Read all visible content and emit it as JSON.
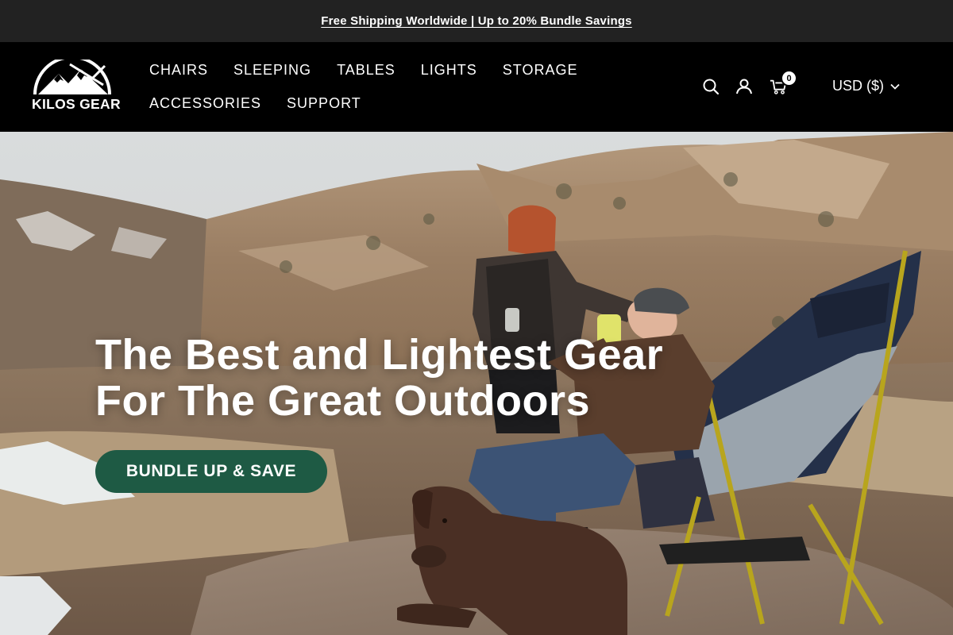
{
  "announcement": {
    "text": "Free Shipping Worldwide | Up to 20% Bundle Savings"
  },
  "brand": {
    "name": "KILOS GEAR"
  },
  "nav": {
    "row1": [
      "CHAIRS",
      "SLEEPING",
      "TABLES",
      "LIGHTS",
      "STORAGE"
    ],
    "row2": [
      "ACCESSORIES",
      "SUPPORT"
    ]
  },
  "header": {
    "icons": [
      "search-icon",
      "account-icon",
      "cart-icon"
    ],
    "cart_count": "0",
    "currency": "USD ($)"
  },
  "hero": {
    "title_line1": "The Best and Lightest Gear",
    "title_line2": "For The Great Outdoors",
    "cta_label": "BUNDLE UP & SAVE"
  },
  "colors": {
    "announcement_bg": "#222222",
    "header_bg": "#000000",
    "cta_bg": "#1e5a44"
  }
}
